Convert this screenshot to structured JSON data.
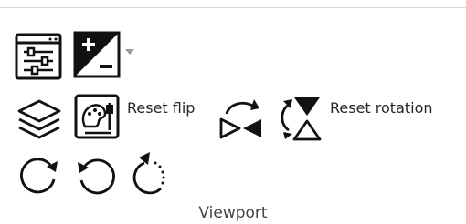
{
  "group": {
    "title": "Viewport"
  },
  "buttons": {
    "reset_flip_label": "Reset flip",
    "reset_rotation_label": "Reset rotation"
  },
  "icons": {
    "viewport_settings": "viewport-settings-icon",
    "window_level": "window-level-icon",
    "dropdown": "chevron-down-icon",
    "layers": "layers-icon",
    "image_adjust": "image-adjust-icon",
    "flip_horizontal": "flip-horizontal-icon",
    "flip_vertical": "flip-vertical-icon",
    "rotate_right": "rotate-right-icon",
    "rotate_left": "rotate-left-icon",
    "free_rotate": "free-rotate-icon"
  }
}
